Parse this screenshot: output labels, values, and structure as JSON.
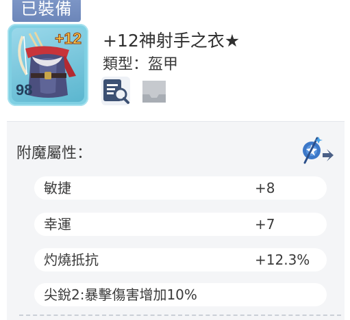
{
  "equipped_tag": "已裝備",
  "item": {
    "refine": "+12",
    "level": "98",
    "name": "+12神射手之衣★",
    "type_label": "類型：",
    "type_value": "盔甲",
    "portrait_icon": "armor-icon"
  },
  "actions": {
    "compare_icon": "compare-icon",
    "slot_icon": "empty-slot-icon"
  },
  "enchant": {
    "title": "附魔屬性：",
    "icon": "enchant-icon",
    "stats": [
      {
        "name": "敏捷",
        "value": "+8"
      },
      {
        "name": "幸運",
        "value": "+7"
      },
      {
        "name": "灼燒抵抗",
        "value": "+12.3%"
      },
      {
        "name": "尖銳2:暴擊傷害增加10%",
        "value": ""
      }
    ]
  },
  "colors": {
    "tag_bg": "#7289bf",
    "portrait_bg": "#7fd0e3",
    "refine_text": "#f6c64a",
    "panel_bg": "#f4f5f7"
  }
}
